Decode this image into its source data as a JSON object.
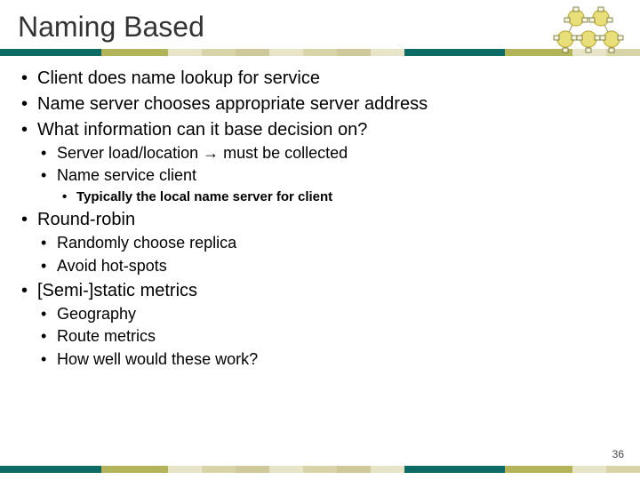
{
  "title": "Naming Based",
  "page_number": "36",
  "bullets": {
    "b1": "Client does name lookup for service",
    "b2": "Name server chooses appropriate server address",
    "b3": "What information can it base decision on?",
    "b3_1": "Server load/location → must be collected",
    "b3_2": "Name service client",
    "b3_2_1": "Typically the local name server for client",
    "b4": "Round-robin",
    "b4_1": "Randomly choose replica",
    "b4_2": "Avoid hot-spots",
    "b5": "[Semi-]static metrics",
    "b5_1": "Geography",
    "b5_2": "Route metrics",
    "b5_3": "How well would these work?"
  },
  "stripe_colors": {
    "teal": "#0d6b66",
    "olive": "#b3b35a",
    "lt1": "#e8e4c8",
    "lt2": "#d8d3a8",
    "lt3": "#cfc89a"
  },
  "diagram_colors": {
    "ring": "#d9c94a",
    "node_border": "#6b6b2f",
    "node_fill": "#f5f3d8"
  }
}
